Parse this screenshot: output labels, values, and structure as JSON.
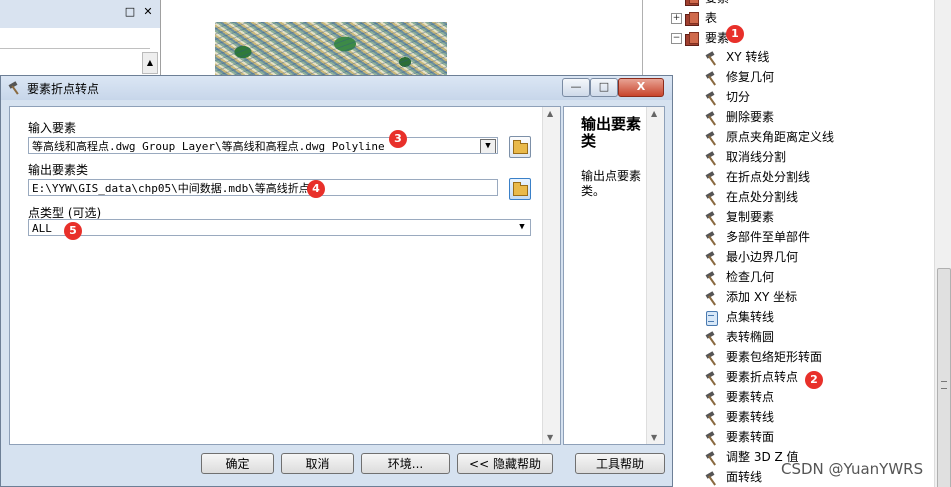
{
  "toolbox": {
    "partial_top": "要素",
    "table_node": "表",
    "features_node": "要素",
    "items": [
      {
        "label": "XY 转线",
        "icon": "hammer-icon"
      },
      {
        "label": "修复几何",
        "icon": "hammer-icon"
      },
      {
        "label": "切分",
        "icon": "hammer-icon"
      },
      {
        "label": "删除要素",
        "icon": "hammer-icon"
      },
      {
        "label": "原点夹角距离定义线",
        "icon": "hammer-icon"
      },
      {
        "label": "取消线分割",
        "icon": "hammer-icon"
      },
      {
        "label": "在折点处分割线",
        "icon": "hammer-icon"
      },
      {
        "label": "在点处分割线",
        "icon": "hammer-icon"
      },
      {
        "label": "复制要素",
        "icon": "hammer-icon"
      },
      {
        "label": "多部件至单部件",
        "icon": "hammer-icon"
      },
      {
        "label": "最小边界几何",
        "icon": "hammer-icon"
      },
      {
        "label": "检查几何",
        "icon": "hammer-icon"
      },
      {
        "label": "添加 XY 坐标",
        "icon": "hammer-icon"
      },
      {
        "label": "点集转线",
        "icon": "script-icon"
      },
      {
        "label": "表转椭圆",
        "icon": "hammer-icon"
      },
      {
        "label": "要素包络矩形转面",
        "icon": "hammer-icon"
      },
      {
        "label": "要素折点转点",
        "icon": "hammer-icon"
      },
      {
        "label": "要素转点",
        "icon": "hammer-icon"
      },
      {
        "label": "要素转线",
        "icon": "hammer-icon"
      },
      {
        "label": "要素转面",
        "icon": "hammer-icon"
      },
      {
        "label": "调整 3D Z 值",
        "icon": "hammer-icon"
      },
      {
        "label": "面转线",
        "icon": "hammer-icon"
      }
    ]
  },
  "dialog": {
    "title": "要素折点转点",
    "minimize": "—",
    "maximize": "□",
    "close": "X",
    "input_label": "输入要素",
    "input_value": "等高线和高程点.dwg Group Layer\\等高线和高程点.dwg Polyline",
    "output_label": "输出要素类",
    "output_value": "E:\\YYW\\GIS_data\\chp05\\中间数据.mdb\\等高线折点",
    "point_type_label": "点类型 (可选)",
    "point_type_value": "ALL",
    "buttons": {
      "ok": "确定",
      "cancel": "取消",
      "environments": "环境...",
      "hide_help": "<< 隐藏帮助",
      "tool_help": "工具帮助"
    },
    "help": {
      "title": "输出要素类",
      "body": "输出点要素类。"
    }
  },
  "badges": [
    "1",
    "2",
    "3",
    "4",
    "5"
  ],
  "watermark": "CSDN @YuanYWRS"
}
